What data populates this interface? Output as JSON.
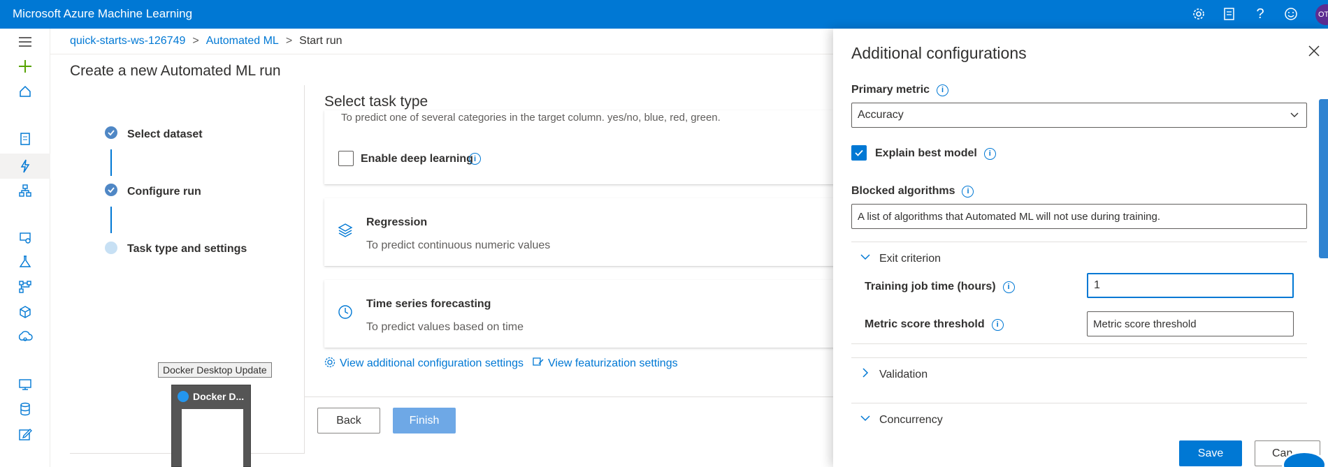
{
  "topbar": {
    "title": "Microsoft Azure Machine Learning",
    "avatar_initials": "OT"
  },
  "breadcrumb": {
    "workspace": "quick-starts-ws-126749",
    "section": "Automated ML",
    "current": "Start run",
    "separator": ">"
  },
  "page": {
    "title": "Create a new Automated ML run"
  },
  "steps": [
    {
      "label": "Select dataset",
      "state": "done"
    },
    {
      "label": "Configure run",
      "state": "done"
    },
    {
      "label": "Task type and settings",
      "state": "current"
    }
  ],
  "task": {
    "section_title": "Select task type",
    "classification_desc": "To predict one of several categories in the target column. yes/no, blue, red, green.",
    "deep_learning_label": "Enable deep learning",
    "regression_title": "Regression",
    "regression_desc": "To predict continuous numeric values",
    "timeseries_title": "Time series forecasting",
    "timeseries_desc": "To predict values based on time",
    "view_additional": "View additional configuration settings",
    "view_featurization": "View featurization settings"
  },
  "footer": {
    "back_label": "Back",
    "finish_label": "Finish"
  },
  "taskbar": {
    "tooltip": "Docker Desktop Update",
    "thumb_title": "Docker D..."
  },
  "panel": {
    "title": "Additional configurations",
    "primary_metric_label": "Primary metric",
    "primary_metric_value": "Accuracy",
    "explain_best_model_label": "Explain best model",
    "explain_best_model_checked": true,
    "blocked_algorithms_label": "Blocked algorithms",
    "blocked_algorithms_placeholder": "A list of algorithms that Automated ML will not use during training.",
    "exit_criterion_label": "Exit criterion",
    "training_time_label": "Training job time (hours)",
    "training_time_value": "1",
    "metric_threshold_label": "Metric score threshold",
    "metric_threshold_placeholder": "Metric score threshold",
    "validation_label": "Validation",
    "concurrency_label": "Concurrency",
    "save_label": "Save",
    "cancel_label": "Can"
  },
  "colors": {
    "accent": "#0078d4",
    "topbar": "#0078d4",
    "step_done": "#4f87c5",
    "finish_disabled": "#6ea8e6"
  }
}
